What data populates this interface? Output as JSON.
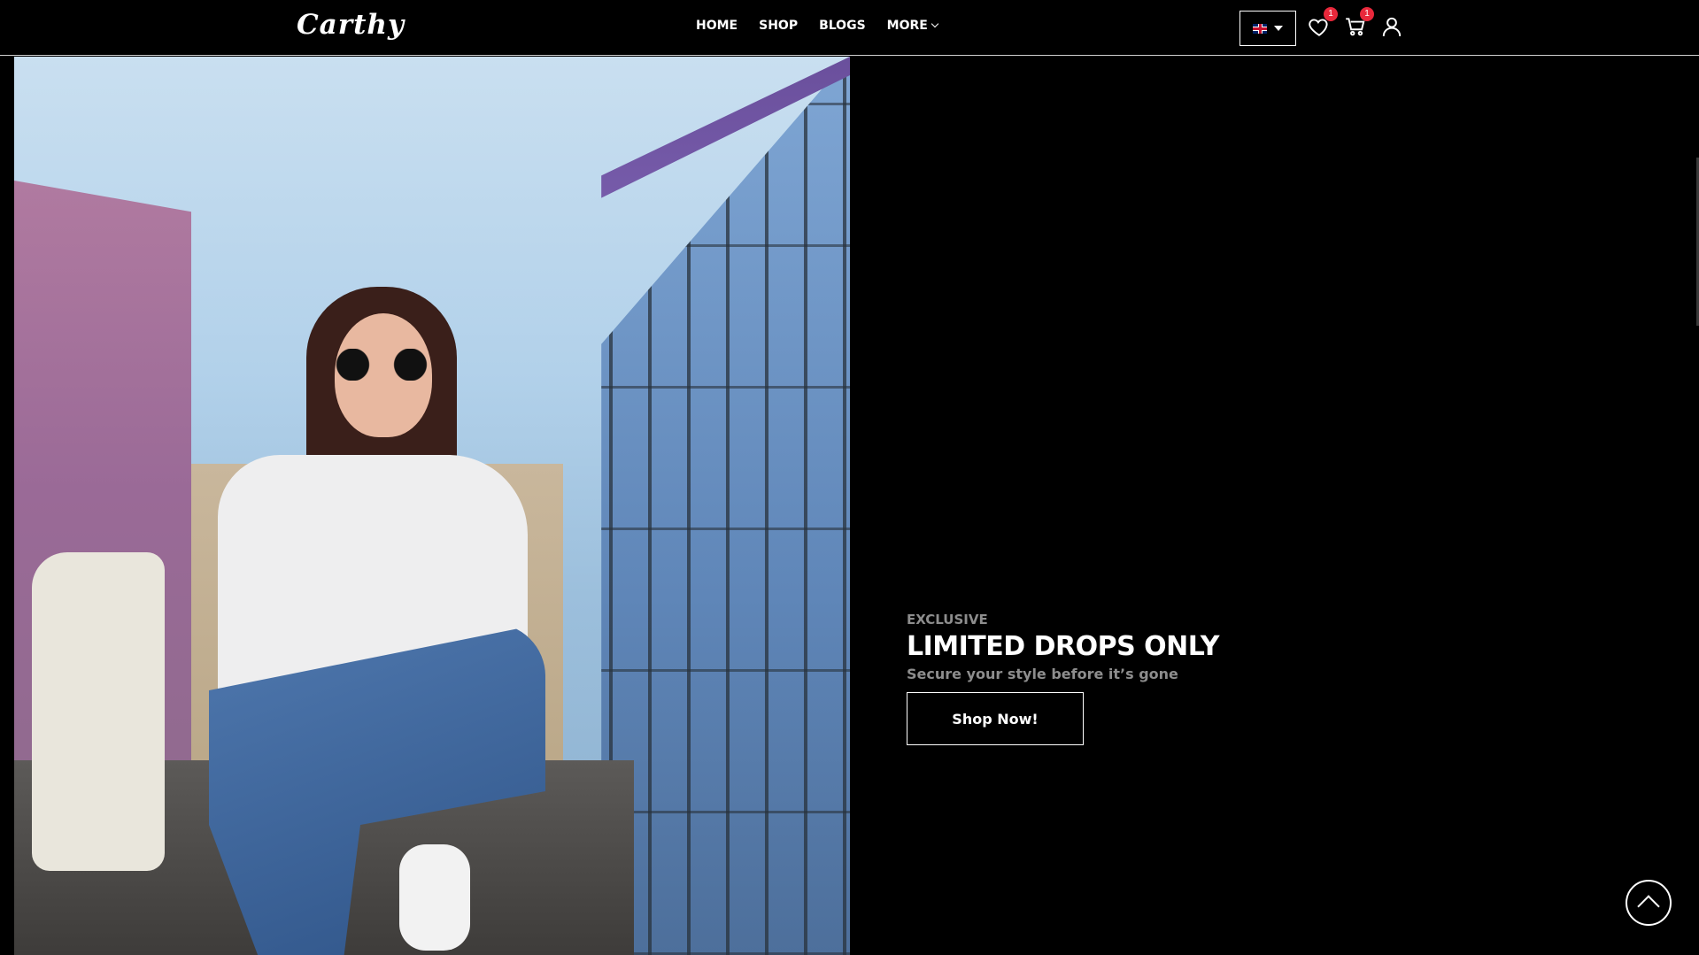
{
  "header": {
    "logo": "Carthy",
    "nav": [
      {
        "label": "HOME"
      },
      {
        "label": "SHOP"
      },
      {
        "label": "BLOGS"
      },
      {
        "label": "MORE",
        "has_dropdown": true
      }
    ],
    "language": {
      "selected": "English",
      "flag": "uk-flag-icon"
    },
    "wishlist": {
      "icon": "heart-icon",
      "count": "1"
    },
    "cart": {
      "icon": "cart-icon",
      "count": "1"
    },
    "account": {
      "icon": "user-icon"
    }
  },
  "hero": {
    "image": {
      "description": "hero-photo"
    },
    "eyebrow": "EXCLUSIVE",
    "title": "LIMITED DROPS ONLY",
    "subtitle": "Secure your style before it’s gone",
    "cta_label": "Shop Now!"
  },
  "back_to_top": {
    "icon": "arrow-up-icon"
  },
  "colors": {
    "background": "#000000",
    "text": "#ffffff",
    "muted": "#8d8d8d",
    "badge": "#e8283b"
  }
}
